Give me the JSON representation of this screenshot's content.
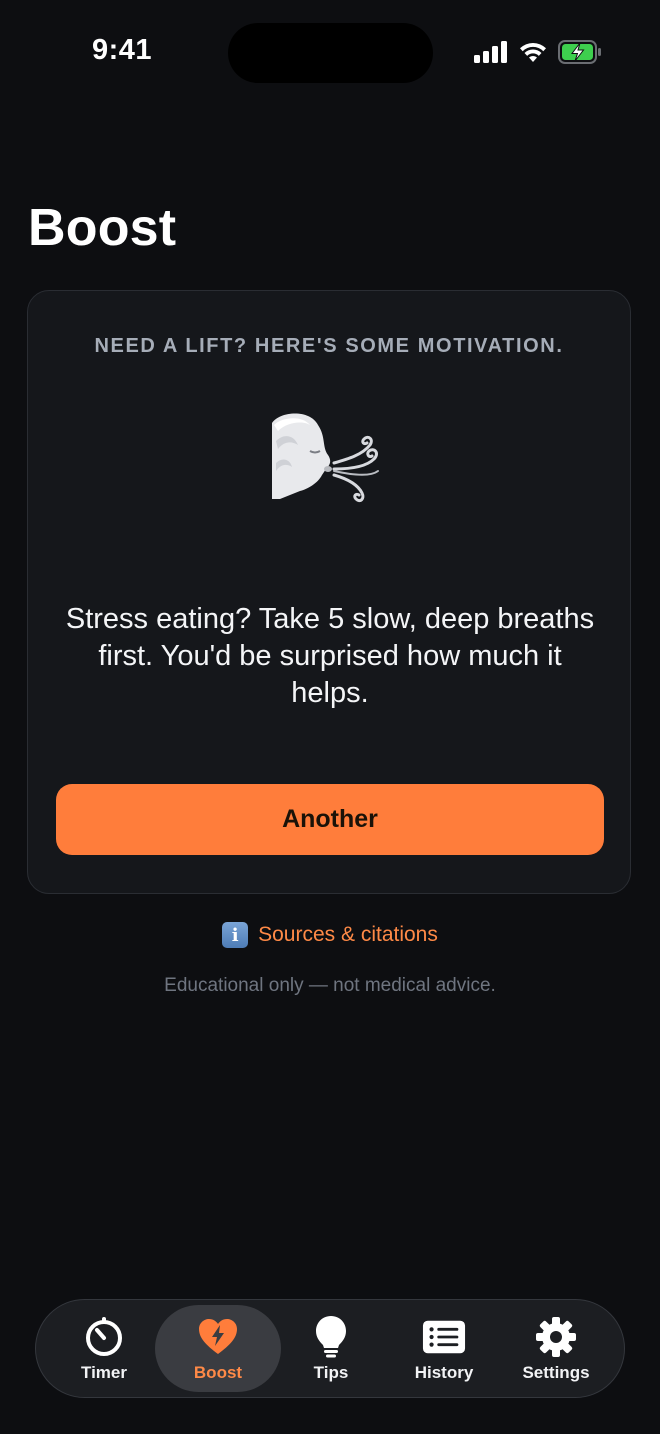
{
  "status_bar": {
    "time": "9:41"
  },
  "page": {
    "title": "Boost"
  },
  "card": {
    "heading": "NEED A LIFT? HERE'S SOME MOTIVATION.",
    "emoji_name": "face-exhaling-icon",
    "quote": "Stress eating? Take 5 slow, deep breaths first. You'd be surprised how much it helps.",
    "button_label": "Another"
  },
  "links": {
    "sources_icon": "i",
    "sources_label": "Sources & citations"
  },
  "footer": {
    "disclaimer": "Educational only — not medical advice."
  },
  "tab_bar": {
    "tabs": [
      {
        "label": "Timer",
        "icon": "timer-icon",
        "active": false
      },
      {
        "label": "Boost",
        "icon": "heart-bolt-icon",
        "active": true
      },
      {
        "label": "Tips",
        "icon": "lightbulb-icon",
        "active": false
      },
      {
        "label": "History",
        "icon": "list-icon",
        "active": false
      },
      {
        "label": "Settings",
        "icon": "gear-icon",
        "active": false
      }
    ]
  },
  "colors": {
    "background": "#0d0e11",
    "card": "#15171b",
    "accent": "#ff7d3b",
    "muted_text": "#6f7580"
  }
}
